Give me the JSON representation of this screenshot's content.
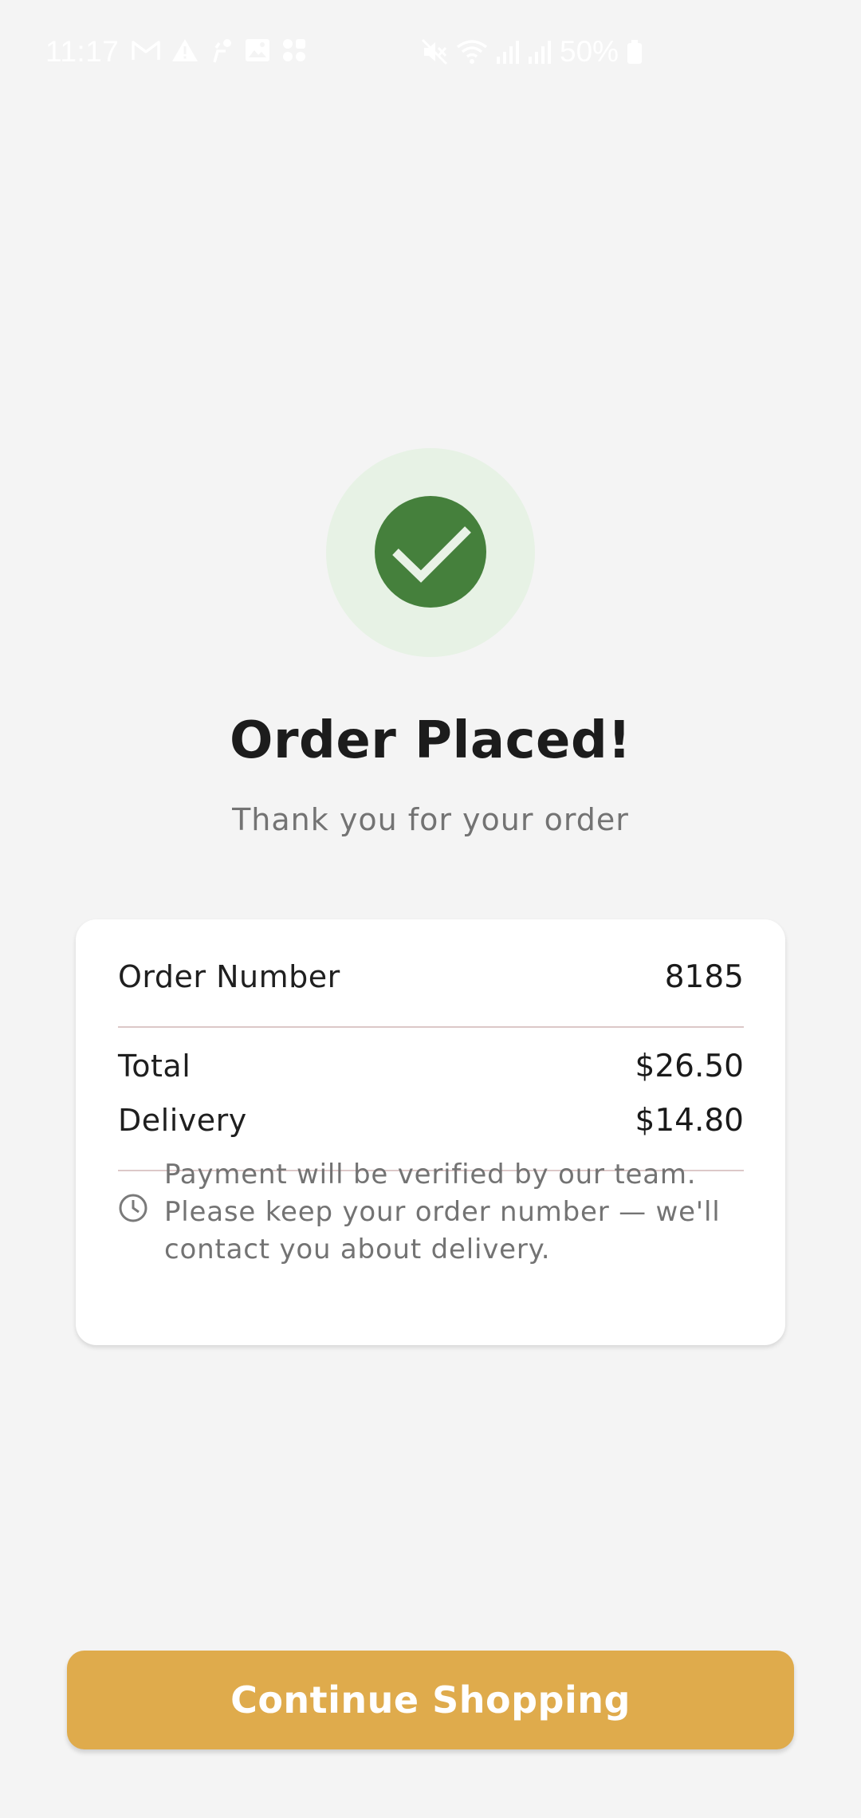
{
  "status_bar": {
    "time": "11:17",
    "battery": "50%",
    "left_icons": [
      "gmail-icon",
      "warning-icon",
      "wallet-icon",
      "image-icon",
      "apps-icon"
    ],
    "right_icons": [
      "mute-icon",
      "wifi-icon",
      "signal-icon",
      "signal-icon",
      "battery-icon"
    ]
  },
  "success": {
    "icon": "check-icon",
    "title": "Order Placed!",
    "subtitle": "Thank you for your order"
  },
  "order": {
    "number_label": "Order Number",
    "number_value": "8185",
    "total_label": "Total",
    "total_value": "$26.50",
    "delivery_label": "Delivery",
    "delivery_value": "$14.80",
    "note_icon": "clock-icon",
    "note": "Payment will be verified by our team. Please keep your order number — we'll contact you about delivery."
  },
  "actions": {
    "continue_label": "Continue Shopping"
  },
  "colors": {
    "background": "#f4f4f4",
    "success_green": "#45803c",
    "success_halo": "#e7f2e5",
    "button": "#dfab4c",
    "divider": "#dcc8c8"
  }
}
